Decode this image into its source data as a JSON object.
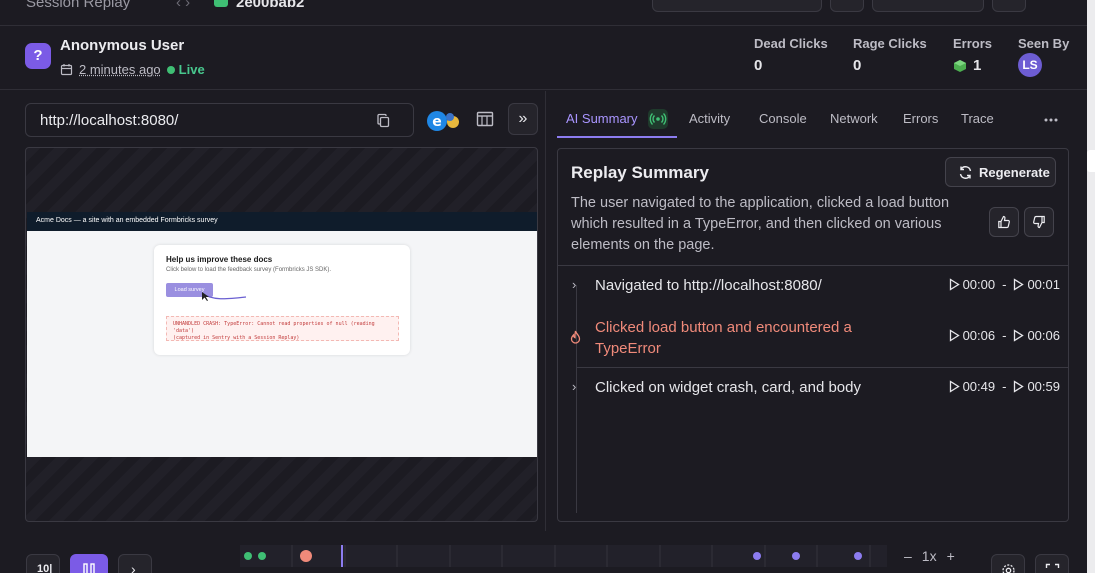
{
  "topbar": {
    "breadcrumb": "Session Replay",
    "session_id": "2e00bab2"
  },
  "user": {
    "avatar_glyph": "?",
    "name": "Anonymous User",
    "time_ago": "2 minutes ago",
    "live_label": "Live"
  },
  "stats": {
    "dead_clicks": {
      "label": "Dead Clicks",
      "value": "0"
    },
    "rage_clicks": {
      "label": "Rage Clicks",
      "value": "0"
    },
    "errors": {
      "label": "Errors",
      "value": "1"
    },
    "seen_by": {
      "label": "Seen By",
      "initials": "LS"
    }
  },
  "player": {
    "url": "http://localhost:8080/",
    "page": {
      "header": "Acme Docs — a site with an embedded Formbricks survey",
      "card_title": "Help us improve these docs",
      "card_subtitle": "Click below to load the feedback survey (Formbricks JS SDK).",
      "button_label": "Load survey",
      "error_line1": "UNHANDLED CRASH: TypeError: Cannot read properties of null (reading 'data')",
      "error_line2": "(captured in Sentry with a Session Replay)"
    }
  },
  "tabs": {
    "ai_summary": "AI Summary",
    "activity": "Activity",
    "console": "Console",
    "network": "Network",
    "errors": "Errors",
    "trace": "Trace"
  },
  "summary": {
    "title": "Replay Summary",
    "regenerate_label": "Regenerate",
    "text": "The user navigated to the application, clicked a load button which resulted in a TypeError, and then clicked on various elements on the page.",
    "events": [
      {
        "text": "Navigated to http://localhost:8080/",
        "start": "00:00",
        "end": "00:01",
        "error": false
      },
      {
        "text": "Clicked load button and encountered a TypeError",
        "start": "00:06",
        "end": "00:06",
        "error": true
      },
      {
        "text": "Clicked on widget crash, card, and body",
        "start": "00:49",
        "end": "00:59",
        "error": false
      }
    ],
    "range_sep": "-"
  },
  "controls": {
    "speed": "1x",
    "zoom_out": "–",
    "zoom_in": "+"
  },
  "colors": {
    "accent": "#8c7cf0",
    "live_green": "#3fbf74",
    "error_red": "#f08a7a"
  }
}
